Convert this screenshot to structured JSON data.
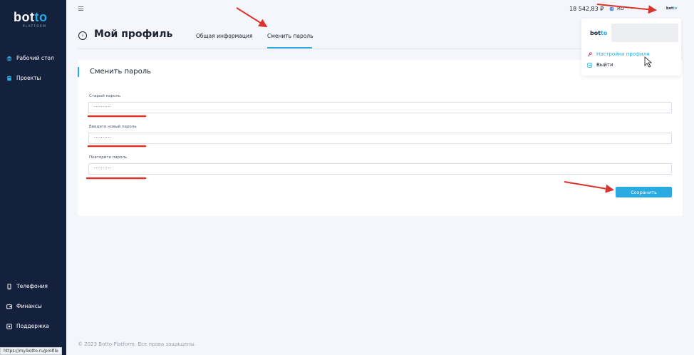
{
  "brand": {
    "logo_main": "bot",
    "logo_accent": "to",
    "logo_sub": "PLATFORM"
  },
  "sidebar": {
    "items": [
      {
        "label": "Рабочий стол",
        "icon": "layers-icon"
      },
      {
        "label": "Проекты",
        "icon": "book-icon"
      },
      {
        "label": "Телефония",
        "icon": "phone-icon"
      },
      {
        "label": "Финансы",
        "icon": "wallet-icon"
      },
      {
        "label": "Поддержка",
        "icon": "support-icon"
      }
    ]
  },
  "topbar": {
    "balance": "18 542,83 ₽",
    "language": "RU",
    "avatar_main": "bot",
    "avatar_accent": "to"
  },
  "header": {
    "back_icon": "arrow-left-circle-icon",
    "title": "Мой профиль",
    "tabs": [
      {
        "label": "Общая информация",
        "active": false
      },
      {
        "label": "Сменить пароль",
        "active": true
      }
    ]
  },
  "form": {
    "title": "Сменить пароль",
    "fields": [
      {
        "label": "Старый пароль",
        "value": "··········"
      },
      {
        "label": "Введите новый пароль",
        "value": "··········"
      },
      {
        "label": "Повторите пароль",
        "value": "··········"
      }
    ],
    "save_label": "Сохранить"
  },
  "dropdown": {
    "logo_main": "bot",
    "logo_accent": "to",
    "items": [
      {
        "label": "Настройки профиля",
        "icon": "wrench-icon"
      },
      {
        "label": "Выйти",
        "icon": "logout-icon"
      }
    ]
  },
  "footer": {
    "copyright": "© 2023 Botto Platform. Все права защищены."
  },
  "status_bar": {
    "url": "https://my.botto.ru/profile"
  },
  "colors": {
    "sidebar": "#14213d",
    "accent": "#29abe2",
    "annotation": "#d9342b",
    "background": "#f4f6fb"
  }
}
